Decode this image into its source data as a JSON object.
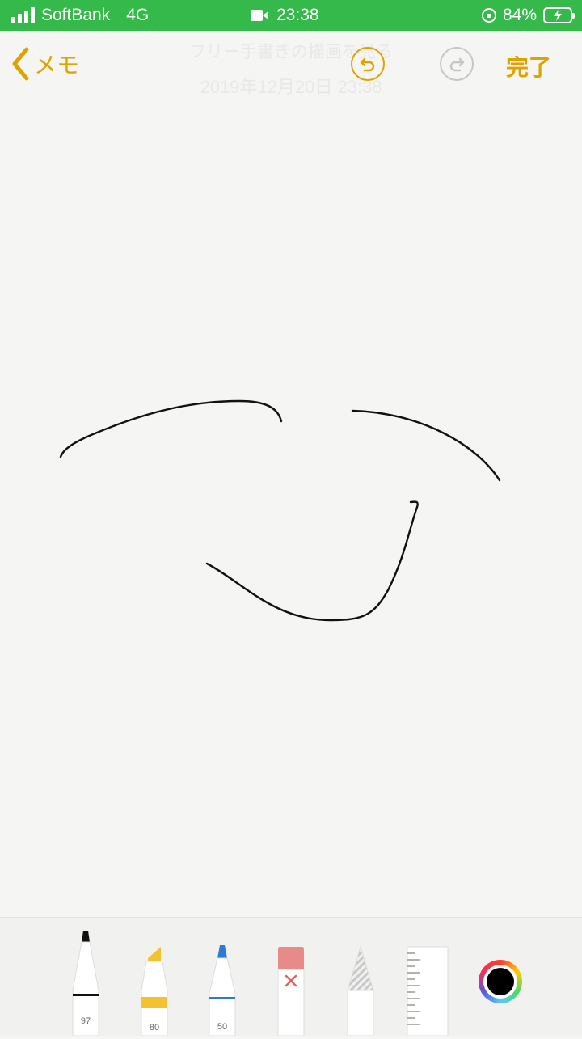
{
  "status_bar": {
    "carrier": "SoftBank",
    "network": "4G",
    "time": "23:38",
    "battery_percent": "84%",
    "signal_bars": 4
  },
  "nav": {
    "back_label": "メモ",
    "done_label": "完了",
    "ghost_title": "フリー手書きの描画を見る",
    "ghost_date": "2019年12月20日 23:38"
  },
  "toolbar": {
    "pen_label": "97",
    "marker_label": "80",
    "pencil_label": "50",
    "selected_color": "#000000",
    "marker_color": "#f2c230",
    "pencil_color": "#2d7ad6",
    "eraser_color": "#e88a8a",
    "accent_color": "#dfa300"
  },
  "icons": [
    "signal-bars-icon",
    "video-camera-icon",
    "rotation-lock-icon",
    "battery-charging-icon",
    "chevron-left-icon",
    "undo-icon",
    "redo-icon",
    "pen-icon",
    "marker-icon",
    "pencil-icon",
    "eraser-icon",
    "lasso-icon",
    "ruler-icon",
    "color-picker-icon"
  ]
}
